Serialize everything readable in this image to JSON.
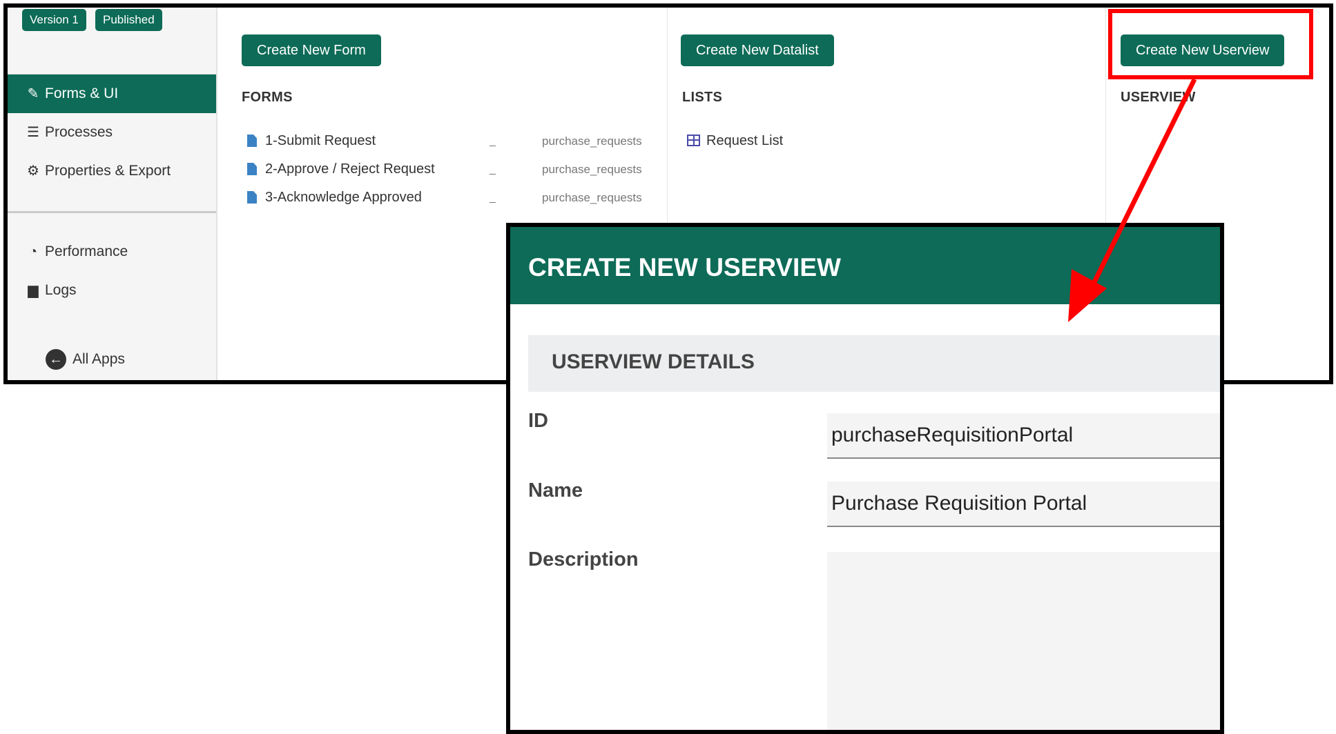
{
  "sidebar": {
    "badges": {
      "version": "Version 1",
      "status": "Published"
    },
    "items": {
      "forms_ui": "Forms & UI",
      "processes": "Processes",
      "properties": "Properties & Export",
      "performance": "Performance",
      "logs": "Logs",
      "all_apps": "All Apps"
    }
  },
  "toolbar": {
    "create_form": "Create New Form",
    "create_datalist": "Create New Datalist",
    "create_userview": "Create New Userview"
  },
  "sections": {
    "forms": "FORMS",
    "lists": "LISTS",
    "userview": "USERVIEW"
  },
  "forms": [
    {
      "name": "1-Submit Request",
      "dash": "_",
      "table": "purchase_requests"
    },
    {
      "name": "2-Approve / Reject Request",
      "dash": "_",
      "table": "purchase_requests"
    },
    {
      "name": "3-Acknowledge Approved",
      "dash": "_",
      "table": "purchase_requests"
    }
  ],
  "lists": [
    {
      "name": "Request List"
    }
  ],
  "dialog": {
    "title": "CREATE NEW USERVIEW",
    "section": "USERVIEW DETAILS",
    "fields": {
      "id_label": "ID",
      "id_value": "purchaseRequisitionPortal",
      "name_label": "Name",
      "name_value": "Purchase Requisition Portal",
      "description_label": "Description",
      "description_value": ""
    }
  },
  "colors": {
    "brand": "#0d6b57",
    "highlight": "#ff0000"
  }
}
